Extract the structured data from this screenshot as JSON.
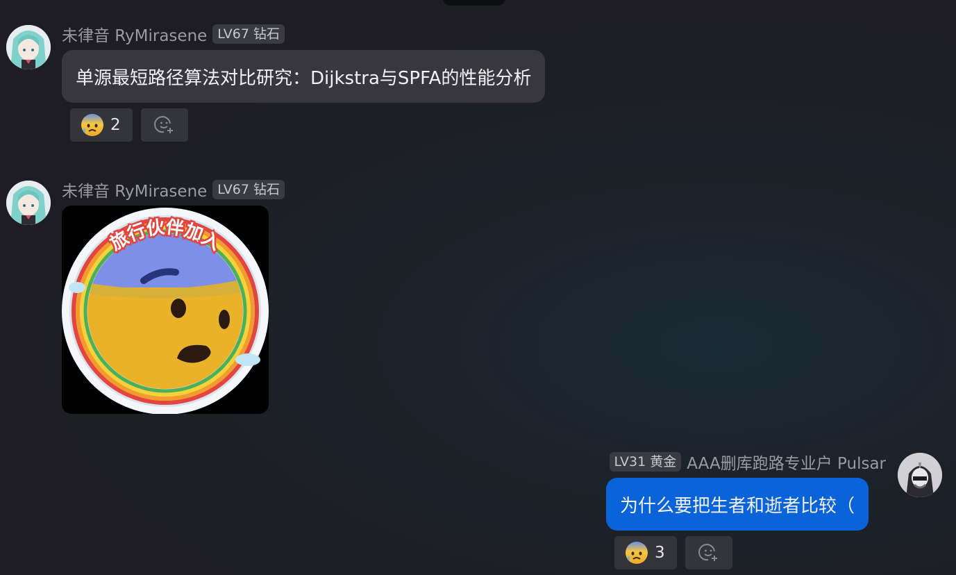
{
  "messages": [
    {
      "sender": "未律音 RyMirasene",
      "level": "LV67 钻石",
      "text": "单源最短路径算法对比研究：Dijkstra与SPFA的性能分析",
      "reactions": [
        {
          "emoji": "😰",
          "icon": "anxious-sweat-face",
          "count": "2"
        }
      ]
    },
    {
      "sender": "未律音 RyMirasene",
      "level": "LV67 钻石",
      "sticker_caption": "旅行伙伴加入"
    },
    {
      "sender": "AAA删库跑路专业户 Pulsar",
      "level": "LV31 黄金",
      "text": "为什么要把生者和逝者比较（",
      "reactions": [
        {
          "emoji": "😰",
          "icon": "anxious-sweat-face",
          "count": "3"
        }
      ]
    }
  ],
  "colors": {
    "incoming_bubble": "#37373d",
    "outgoing_bubble": "#0a63d8",
    "badge_bg": "#3a3a42"
  }
}
